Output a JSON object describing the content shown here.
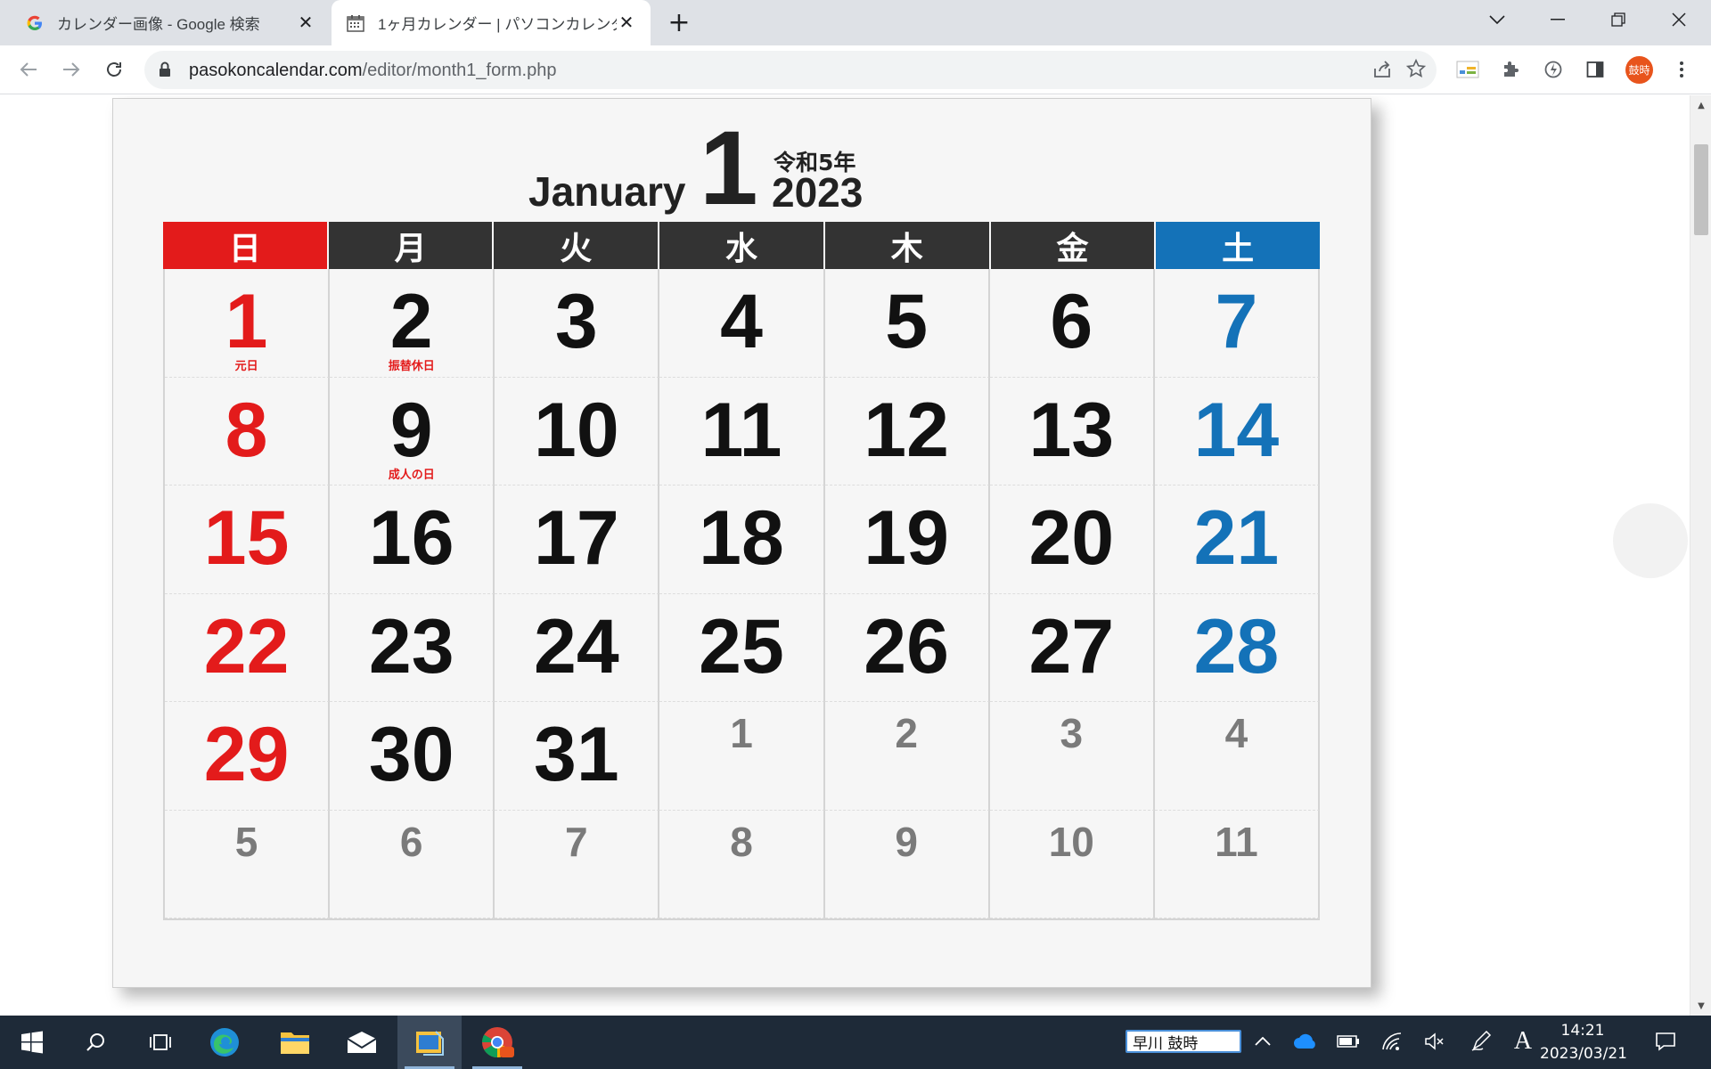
{
  "browser": {
    "tabs": [
      {
        "title": "カレンダー画像 - Google 検索",
        "active": false
      },
      {
        "title": "1ヶ月カレンダー | パソコンカレンダーサイト",
        "active": true
      }
    ],
    "url_host": "pasokoncalendar.com",
    "url_path": "/editor/month1_form.php",
    "avatar_text": "鼓時"
  },
  "calendar": {
    "month_name": "January",
    "month_number": "1",
    "era": "令和5年",
    "year": "2023",
    "weekdays": [
      "日",
      "月",
      "火",
      "水",
      "木",
      "金",
      "土"
    ],
    "weeks": [
      [
        {
          "n": "1",
          "hol": "元日"
        },
        {
          "n": "2",
          "hol": "振替休日"
        },
        {
          "n": "3"
        },
        {
          "n": "4"
        },
        {
          "n": "5"
        },
        {
          "n": "6"
        },
        {
          "n": "7"
        }
      ],
      [
        {
          "n": "8"
        },
        {
          "n": "9",
          "hol": "成人の日"
        },
        {
          "n": "10"
        },
        {
          "n": "11"
        },
        {
          "n": "12"
        },
        {
          "n": "13"
        },
        {
          "n": "14"
        }
      ],
      [
        {
          "n": "15"
        },
        {
          "n": "16"
        },
        {
          "n": "17"
        },
        {
          "n": "18"
        },
        {
          "n": "19"
        },
        {
          "n": "20"
        },
        {
          "n": "21"
        }
      ],
      [
        {
          "n": "22"
        },
        {
          "n": "23"
        },
        {
          "n": "24"
        },
        {
          "n": "25"
        },
        {
          "n": "26"
        },
        {
          "n": "27"
        },
        {
          "n": "28"
        }
      ],
      [
        {
          "n": "29"
        },
        {
          "n": "30"
        },
        {
          "n": "31"
        },
        {
          "n": "1",
          "other": true
        },
        {
          "n": "2",
          "other": true
        },
        {
          "n": "3",
          "other": true
        },
        {
          "n": "4",
          "other": true
        }
      ],
      [
        {
          "n": "5",
          "other": true
        },
        {
          "n": "6",
          "other": true
        },
        {
          "n": "7",
          "other": true
        },
        {
          "n": "8",
          "other": true
        },
        {
          "n": "9",
          "other": true
        },
        {
          "n": "10",
          "other": true
        },
        {
          "n": "11",
          "other": true
        }
      ]
    ],
    "colors": {
      "sunday": "#e31b1b",
      "saturday": "#1472b8",
      "weekday_header": "#333333"
    }
  },
  "taskbar": {
    "ime_name": "早川 鼓時",
    "ime_mode": "A",
    "time": "14:21",
    "date": "2023/03/21"
  }
}
